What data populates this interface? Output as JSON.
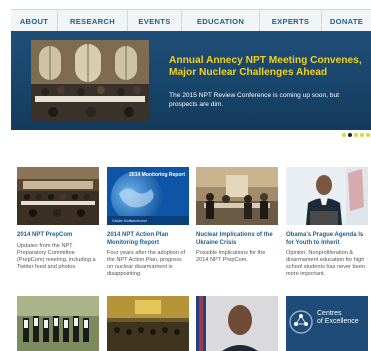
{
  "nav": {
    "items": [
      {
        "label": "ABOUT"
      },
      {
        "label": "RESEARCH"
      },
      {
        "label": "EVENTS"
      },
      {
        "label": "EDUCATION"
      },
      {
        "label": "EXPERTS"
      },
      {
        "label": "DONATE"
      }
    ]
  },
  "hero": {
    "title": "Annual Annecy NPT Meeting Convenes, Major Nuclear Challenges Ahead",
    "subtitle": "The 2015 NPT Review Conference is coming up soon, but prospects are dim."
  },
  "slider": {
    "dot_count": 5,
    "active_index": 1
  },
  "cards": [
    {
      "title": "2014 NPT PrepCom",
      "desc": "Updates from the NPT Preparatory Committee (PrepCom) meeting, including a Twitter feed and photos."
    },
    {
      "title": "2014 NPT Action Plan Monitoring Report",
      "desc": "Four years after the adoption of the NPT Action Plan, progress on nuclear disarmament is disappointing.",
      "image_text": "2014 Monitoring Report",
      "image_caption": "Gaidar Multisturikuner"
    },
    {
      "title": "Nuclear Implications of the Ukraine Crisis",
      "desc": "Possible implications for the 2014 NPT PrepCom."
    },
    {
      "title": "Obama's Prague Agenda Is for Youth to Inherit",
      "desc": "Opinion: Nonproliferation & disarmament education for high school students has never been more important."
    }
  ],
  "bottom_row": {
    "centres_line1": "Centres",
    "centres_line2": "of Excellence"
  },
  "colors": {
    "nav_text": "#1f5f8b",
    "hero_bg": "#1f4e79",
    "hero_title": "#f3d21b",
    "dot_inactive": "#d7dc28",
    "dot_active": "#202020",
    "card_title": "#1f5f8b"
  }
}
